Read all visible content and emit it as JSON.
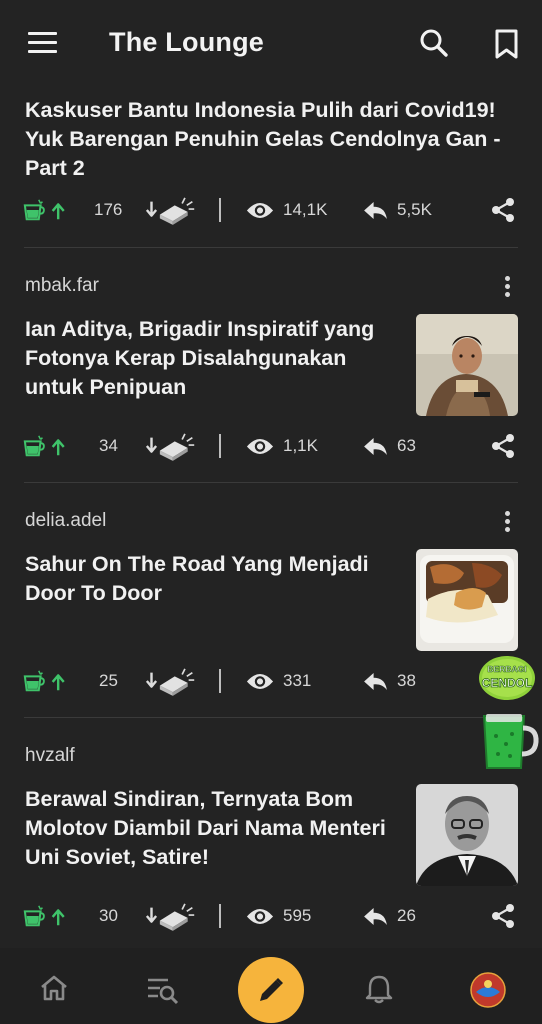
{
  "app": {
    "title": "The Lounge"
  },
  "icons": {
    "menu": "hamburger-menu-icon",
    "search": "search-icon",
    "bookmark": "bookmark-icon",
    "upvote": "cendol-glass-upvote-icon",
    "downvote": "bata-brick-downvote-icon",
    "views": "eye-icon",
    "replies": "reply-arrow-icon",
    "share": "share-icon",
    "more": "more-vertical-icon"
  },
  "colors": {
    "background": "#232323",
    "accent_green": "#3fc36a",
    "fab": "#f6b43c",
    "text": "#f1f1f1"
  },
  "posts": [
    {
      "author": "",
      "title": "Kaskuser Bantu Indonesia Pulih dari Covid19! Yuk Barengan Penuhin Gelas Cendolnya Gan - Part 2",
      "cendol": "176",
      "views": "14,1K",
      "replies": "5,5K",
      "has_thumbnail": false
    },
    {
      "author": "mbak.far",
      "title": "Ian Aditya, Brigadir Inspiratif yang Fotonya Kerap Disalahgunakan untuk Penipuan",
      "cendol": "34",
      "views": "1,1K",
      "replies": "63",
      "has_thumbnail": true
    },
    {
      "author": "delia.adel",
      "title": "Sahur On The Road Yang Menjadi Door To Door",
      "cendol": "25",
      "views": "331",
      "replies": "38",
      "has_thumbnail": true
    },
    {
      "author": "hvzalf",
      "title": "Berawal Sindiran, Ternyata Bom Molotov Diambil Dari Nama Menteri Uni Soviet, Satire!",
      "cendol": "30",
      "views": "595",
      "replies": "26",
      "has_thumbnail": true
    }
  ],
  "floating": {
    "badge_line1": "BERBAGI",
    "badge_line2": "CENDOL"
  },
  "bottom_nav": [
    {
      "name": "home",
      "icon": "home-icon"
    },
    {
      "name": "search-threads",
      "icon": "list-search-icon"
    },
    {
      "name": "create",
      "icon": "pencil-icon"
    },
    {
      "name": "notifications",
      "icon": "bell-icon"
    },
    {
      "name": "profile",
      "icon": "avatar"
    }
  ]
}
